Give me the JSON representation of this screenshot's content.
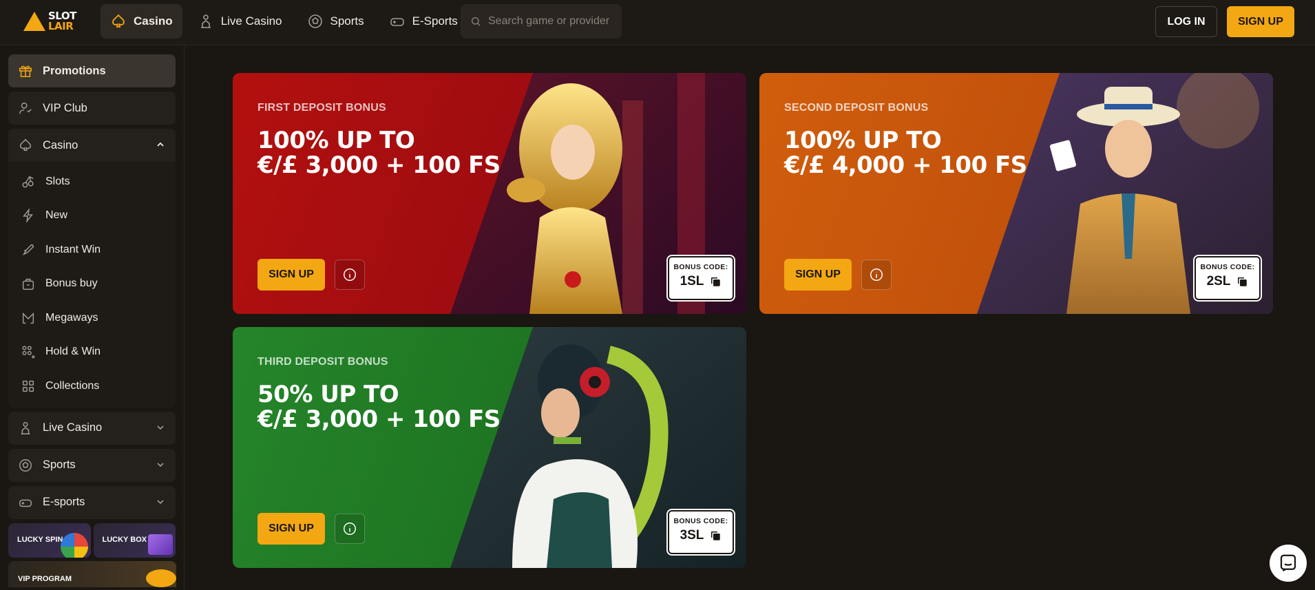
{
  "brand": {
    "line1": "SLOT",
    "line2": "LAIR",
    "accent": "#f3a712"
  },
  "topnav": {
    "items": [
      {
        "label": "Casino",
        "icon": "spade-icon",
        "active": true
      },
      {
        "label": "Live Casino",
        "icon": "dealer-icon",
        "active": false
      },
      {
        "label": "Sports",
        "icon": "soccer-ball-icon",
        "active": false
      },
      {
        "label": "E-Sports",
        "icon": "gamepad-icon",
        "active": false
      }
    ],
    "search_placeholder": "Search game or provider",
    "login_label": "LOG IN",
    "signup_label": "SIGN UP"
  },
  "sidebar": {
    "promotions": "Promotions",
    "vip_club": "VIP Club",
    "casino": "Casino",
    "casino_sub": [
      "Slots",
      "New",
      "Instant Win",
      "Bonus buy",
      "Megaways",
      "Hold & Win",
      "Collections"
    ],
    "live_casino": "Live Casino",
    "sports": "Sports",
    "esports": "E-sports",
    "lucky_spin": "LUCKY SPIN",
    "lucky_box": "LUCKY BOX",
    "vip_program": "VIP PROGRAM"
  },
  "cards": [
    {
      "subtitle": "FIRST DEPOSIT BONUS",
      "headline_1": "100% UP TO",
      "headline_2": "€/£ 3,000 + 100 FS",
      "button": "SIGN UP",
      "code_label": "BONUS CODE:",
      "code": "1SL",
      "color": "#a90f12"
    },
    {
      "subtitle": "SECOND DEPOSIT BONUS",
      "headline_1": "100% UP TO",
      "headline_2": "€/£ 4,000 + 100 FS",
      "button": "SIGN UP",
      "code_label": "BONUS CODE:",
      "code": "2SL",
      "color": "#c4560c"
    },
    {
      "subtitle": "THIRD DEPOSIT BONUS",
      "headline_1": "50% UP TO",
      "headline_2": "€/£ 3,000 + 100 FS",
      "button": "SIGN UP",
      "code_label": "BONUS CODE:",
      "code": "3SL",
      "color": "#1f7a22"
    }
  ]
}
